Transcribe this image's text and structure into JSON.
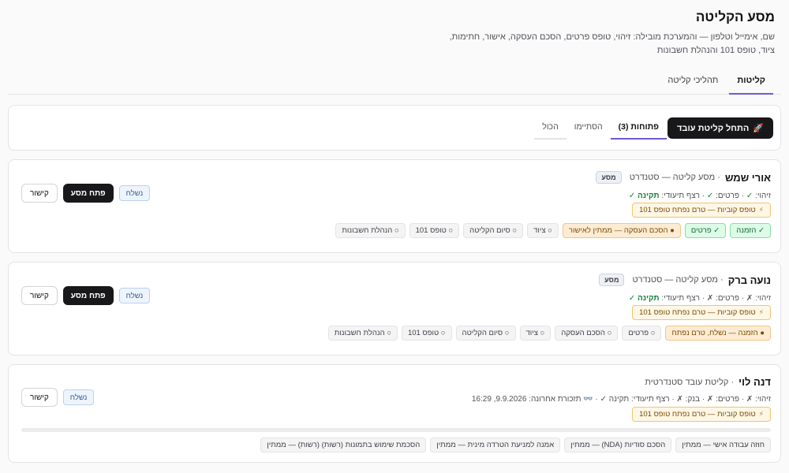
{
  "page": {
    "title": "מסע הקליטה",
    "subtitle": "שם, אימייל וטלפון — והמערכת מובילה: זיהוי, טופס פרטים, הסכם העסקה, אישור, חתימות, ציוד, טופס 101 והנהלת חשבונות"
  },
  "main_tabs": [
    {
      "label": "קליטות",
      "active": true
    },
    {
      "label": "תהליכי קליטה",
      "active": false
    }
  ],
  "toolbar": {
    "start_label": "התחל קליטת עובד",
    "start_icon": "rocket-icon",
    "filters": [
      {
        "label": "פתוחות (3)",
        "active": true
      },
      {
        "label": "הסתיימו",
        "active": false
      },
      {
        "label": "הכול",
        "active": false
      }
    ]
  },
  "employees": [
    {
      "name": "אורי שמש",
      "track": "מסע קליטה — סטנדרט",
      "badge": "מסע",
      "status_prefix": "זיהוי: ",
      "status_id": "✓",
      "status_mid": " · פרטים: ",
      "status_details": "✓",
      "status_docs_label": " · רצף תיעודי: ",
      "status_docs": "תקינה ✓",
      "warning": "טופס קוביות — טרם נפתח טופס 101",
      "steps": [
        {
          "label": "✓ הזמנה",
          "state": "done"
        },
        {
          "label": "✓ פרטים",
          "state": "done"
        },
        {
          "label": "● הסכם העסקה — ממתין לאישור",
          "state": "pending"
        },
        {
          "label": "○ ציוד",
          "state": "todo"
        },
        {
          "label": "○ סיום הקליטה",
          "state": "todo"
        },
        {
          "label": "○ טופס 101",
          "state": "todo"
        },
        {
          "label": "○ הנהלת חשבונות",
          "state": "todo"
        }
      ],
      "sent_label": "נשלח",
      "open_label": "פתח מסע",
      "link_label": "קישור"
    },
    {
      "name": "נועה ברק",
      "track": "מסע קליטה — סטנדרט",
      "badge": "מסע",
      "status_prefix": "זיהוי: ",
      "status_id": "✗",
      "status_mid": " · פרטים: ",
      "status_details": "✗",
      "status_docs_label": " · רצף תיעודי: ",
      "status_docs": "תקינה ✓",
      "warning": "טופס קוביות — טרם נפתח טופס 101",
      "steps": [
        {
          "label": "● הזמנה — נשלח, טרם נפתח",
          "state": "pending"
        },
        {
          "label": "○ פרטים",
          "state": "todo"
        },
        {
          "label": "○ הסכם העסקה",
          "state": "todo"
        },
        {
          "label": "○ ציוד",
          "state": "todo"
        },
        {
          "label": "○ סיום הקליטה",
          "state": "todo"
        },
        {
          "label": "○ טופס 101",
          "state": "todo"
        },
        {
          "label": "○ הנהלת חשבונות",
          "state": "todo"
        }
      ],
      "sent_label": "נשלח",
      "open_label": "פתח מסע",
      "link_label": "קישור"
    },
    {
      "name": "דנה לוי",
      "track": "קליטת עובד סטנדרטית",
      "status_line": "זיהוי: ✗ · פרטים: ✗ · בנק: ✗ · רצף תיעודי: תקינה ✓ · 👓 תזכורת אחרונה: 9.9.2026, 16:29",
      "warning": "טופס קוביות — טרם נפתח טופס 101",
      "progress": 0,
      "steps": [
        {
          "label": "חוזה עבודה אישי — ממתין",
          "state": "todo"
        },
        {
          "label": "הסכם סודיות (NDA) — ממתין",
          "state": "todo"
        },
        {
          "label": "אמנה למניעת הטרדה מינית — ממתין",
          "state": "todo"
        },
        {
          "label": "הסכמת שימוש בתמונות (רשות) (רשות) — ממתין",
          "state": "todo"
        }
      ],
      "sent_label": "נשלח",
      "link_label": "קישור"
    }
  ]
}
